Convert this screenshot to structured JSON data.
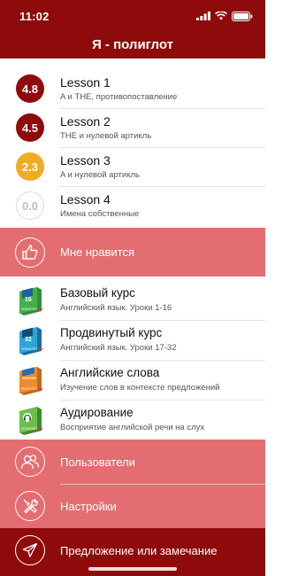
{
  "status": {
    "time": "11:02"
  },
  "header": {
    "title": "Я - полиглот"
  },
  "colors": {
    "header_bg": "#8f0b0b",
    "band_bg": "#e36d71",
    "rating_high": "#8f0b0b",
    "rating_mid": "#f0ad23"
  },
  "lessons": [
    {
      "rating": "4.8",
      "title": "Lesson 1",
      "subtitle": "A и THE, противопоставление"
    },
    {
      "rating": "4.5",
      "title": "Lesson 2",
      "subtitle": "THE и нулевой артикль"
    },
    {
      "rating": "2.3",
      "title": "Lesson 3",
      "subtitle": "A и нулевой артикль"
    },
    {
      "rating": "0.0",
      "title": "Lesson 4",
      "subtitle": "Имена собственные"
    }
  ],
  "like": {
    "label": "Мне нравится",
    "icon": "thumbs-up-icon"
  },
  "courses": [
    {
      "title": "Базовый курс",
      "subtitle": "Английский язык. Уроки 1-16",
      "book_text": "16",
      "book_caption": "ПОЛИГЛОТ",
      "icon": "book-green-icon"
    },
    {
      "title": "Продвинутый курс",
      "subtitle": "Английский язык. Уроки 17-32",
      "book_text": "32",
      "book_caption": "ПОЛИГЛОТ",
      "icon": "book-blue-icon"
    },
    {
      "title": "Английские слова",
      "subtitle": "Изучение слов в контексте предложений",
      "book_text": "ENGLISH",
      "book_caption": "ПОЛИГЛОТ",
      "icon": "book-orange-icon"
    },
    {
      "title": "Аудирование",
      "subtitle": "Восприятие английской речи на слух",
      "book_text": "",
      "book_caption": "ПОЛИГЛОТ",
      "icon": "book-headphones-icon"
    }
  ],
  "menu": [
    {
      "label": "Пользователи",
      "icon": "users-icon"
    },
    {
      "label": "Настройки",
      "icon": "settings-tools-icon"
    }
  ],
  "feedback": {
    "label": "Предложение или замечание",
    "icon": "paper-plane-icon"
  }
}
